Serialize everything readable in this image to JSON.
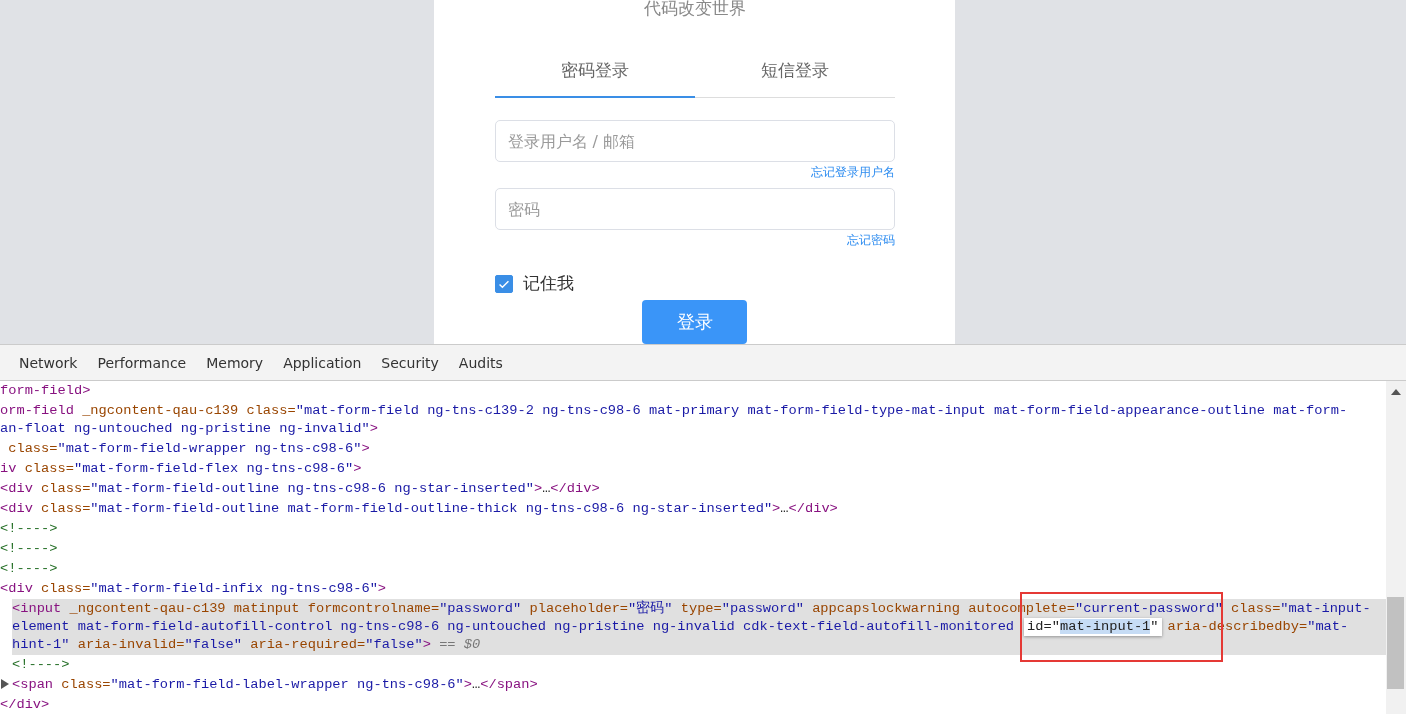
{
  "login": {
    "title": "代码改变世界",
    "tabs": [
      {
        "label": "密码登录",
        "selected": true
      },
      {
        "label": "短信登录",
        "selected": false
      }
    ],
    "fields": [
      {
        "placeholder": "登录用户名 / 邮箱",
        "link": "忘记登录用户名"
      },
      {
        "placeholder": "密码",
        "link": "忘记密码"
      }
    ],
    "remember": {
      "label": "记住我",
      "checked": true
    },
    "submit": "登录"
  },
  "devtools": {
    "tabs": [
      {
        "label": "Network",
        "selected": false
      },
      {
        "label": "Performance",
        "selected": false
      },
      {
        "label": "Memory",
        "selected": false
      },
      {
        "label": "Application",
        "selected": false
      },
      {
        "label": "Security",
        "selected": false
      },
      {
        "label": "Audits",
        "selected": false
      }
    ],
    "nodes": [
      {
        "selected": false,
        "lines": [
          [
            {
              "kind": "tag",
              "t": "form-field>"
            }
          ]
        ]
      },
      {
        "selected": false,
        "lines": [
          [
            {
              "kind": "tag",
              "t": "orm-field"
            },
            {
              "kind": "attr",
              "t": " _ngcontent-qau-c139 class="
            },
            {
              "kind": "value",
              "t": "\"mat-form-field ng-tns-c139-2 ng-tns-c98-6 mat-primary mat-form-field-type-mat-input mat-form-field-appearance-outline mat-form-"
            }
          ],
          [
            {
              "kind": "value",
              "t": "an-float ng-untouched ng-pristine ng-invalid\""
            },
            {
              "kind": "tag",
              "t": ">"
            }
          ]
        ]
      },
      {
        "selected": false,
        "lines": [
          [
            {
              "kind": "attr",
              "t": " class="
            },
            {
              "kind": "value",
              "t": "\"mat-form-field-wrapper ng-tns-c98-6\""
            },
            {
              "kind": "tag",
              "t": ">"
            }
          ]
        ]
      },
      {
        "selected": false,
        "lines": [
          [
            {
              "kind": "tag",
              "t": "iv"
            },
            {
              "kind": "attr",
              "t": " class="
            },
            {
              "kind": "value",
              "t": "\"mat-form-field-flex ng-tns-c98-6\""
            },
            {
              "kind": "tag",
              "t": ">"
            }
          ]
        ]
      },
      {
        "selected": false,
        "lines": [
          [
            {
              "kind": "tag",
              "t": "<div"
            },
            {
              "kind": "attr",
              "t": " class="
            },
            {
              "kind": "value",
              "t": "\"mat-form-field-outline ng-tns-c98-6 ng-star-inserted\""
            },
            {
              "kind": "tag",
              "t": ">"
            },
            {
              "kind": "text",
              "t": "…"
            },
            {
              "kind": "tag",
              "t": "</div>"
            }
          ]
        ]
      },
      {
        "selected": false,
        "lines": [
          [
            {
              "kind": "tag",
              "t": "<div"
            },
            {
              "kind": "attr",
              "t": " class="
            },
            {
              "kind": "value",
              "t": "\"mat-form-field-outline mat-form-field-outline-thick ng-tns-c98-6 ng-star-inserted\""
            },
            {
              "kind": "tag",
              "t": ">"
            },
            {
              "kind": "text",
              "t": "…"
            },
            {
              "kind": "tag",
              "t": "</div>"
            }
          ]
        ]
      },
      {
        "selected": false,
        "lines": [
          [
            {
              "kind": "comment",
              "t": "<!---->"
            }
          ]
        ]
      },
      {
        "selected": false,
        "lines": [
          [
            {
              "kind": "comment",
              "t": "<!---->"
            }
          ]
        ]
      },
      {
        "selected": false,
        "lines": [
          [
            {
              "kind": "comment",
              "t": "<!---->"
            }
          ]
        ]
      },
      {
        "selected": false,
        "lines": [
          [
            {
              "kind": "tag",
              "t": "<div"
            },
            {
              "kind": "attr",
              "t": " class="
            },
            {
              "kind": "value",
              "t": "\"mat-form-field-infix ng-tns-c98-6\""
            },
            {
              "kind": "tag",
              "t": ">"
            }
          ]
        ],
        "children": [
          {
            "selected": true,
            "lines": [
              [
                {
                  "kind": "tag",
                  "t": "<input"
                },
                {
                  "kind": "attr",
                  "t": " _ngcontent-qau-c139 matinput formcontrolname="
                },
                {
                  "kind": "value",
                  "t": "\"password\""
                },
                {
                  "kind": "attr",
                  "t": " placeholder="
                },
                {
                  "kind": "value",
                  "t": "\"密码\""
                },
                {
                  "kind": "attr",
                  "t": " type="
                },
                {
                  "kind": "value",
                  "t": "\"password\""
                },
                {
                  "kind": "attr",
                  "t": " appcapslockwarning autocomplete="
                },
                {
                  "kind": "value",
                  "t": "\"current-password\""
                },
                {
                  "kind": "attr",
                  "t": " class="
                },
                {
                  "kind": "value",
                  "t": "\"mat-input-"
                }
              ],
              [
                {
                  "kind": "value",
                  "t": "element mat-form-field-autofill-control ng-tns-c98-6 ng-untouched ng-pristine ng-invalid cdk-text-field-autofill-monitored"
                },
                {
                  "kind": "tooltip",
                  "pre": "id=\"",
                  "hl": "mat-input-1",
                  "post": "\""
                },
                {
                  "kind": "attr",
                  "t": "aria-describedby="
                },
                {
                  "kind": "value",
                  "t": "\"mat-"
                }
              ],
              [
                {
                  "kind": "value",
                  "t": "hint-1\""
                },
                {
                  "kind": "attr",
                  "t": " aria-invalid="
                },
                {
                  "kind": "value",
                  "t": "\"false\""
                },
                {
                  "kind": "attr",
                  "t": " aria-required="
                },
                {
                  "kind": "value",
                  "t": "\"false\""
                },
                {
                  "kind": "tag",
                  "t": ">"
                },
                {
                  "kind": "ref",
                  "t": " == $0"
                }
              ]
            ]
          },
          {
            "selected": false,
            "lines": [
              [
                {
                  "kind": "comment",
                  "t": "<!---->"
                }
              ]
            ]
          },
          {
            "selected": false,
            "collapsed": true,
            "lines": [
              [
                {
                  "kind": "tag",
                  "t": "<span"
                },
                {
                  "kind": "attr",
                  "t": " class="
                },
                {
                  "kind": "value",
                  "t": "\"mat-form-field-label-wrapper ng-tns-c98-6\""
                },
                {
                  "kind": "tag",
                  "t": ">"
                },
                {
                  "kind": "text",
                  "t": "…"
                },
                {
                  "kind": "tag",
                  "t": "</span>"
                }
              ]
            ]
          }
        ]
      },
      {
        "selected": false,
        "lines": [
          [
            {
              "kind": "tag",
              "t": "</div>"
            }
          ]
        ]
      }
    ]
  }
}
